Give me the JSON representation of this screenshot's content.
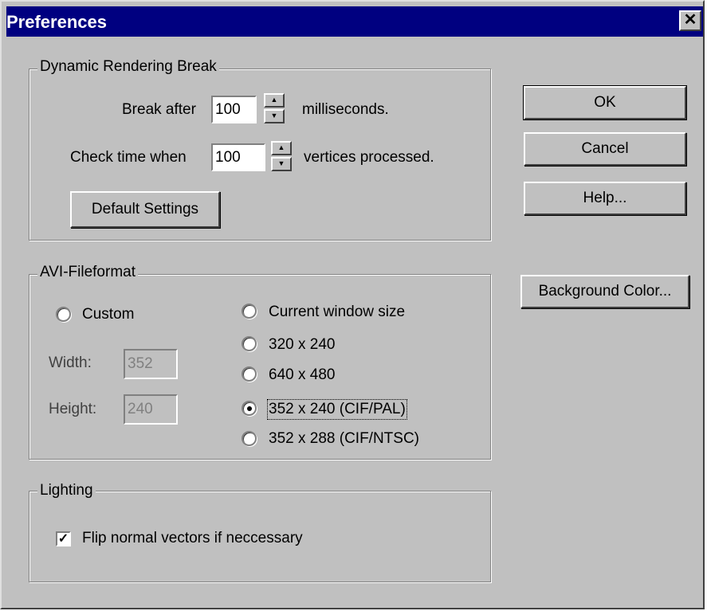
{
  "window": {
    "title": "Preferences",
    "close_glyph": "✕"
  },
  "rendering": {
    "group_label": "Dynamic Rendering Break",
    "break_after_label": "Break after",
    "break_after_value": "100",
    "break_after_unit": "milliseconds.",
    "check_time_label": "Check time when",
    "check_time_value": "100",
    "check_time_unit": "vertices processed.",
    "default_settings_label": "Default Settings"
  },
  "buttons": {
    "ok": "OK",
    "cancel": "Cancel",
    "help": "Help...",
    "background_color": "Background Color..."
  },
  "avi": {
    "group_label": "AVI-Fileformat",
    "custom_label": "Custom",
    "width_label": "Width:",
    "width_value": "352",
    "height_label": "Height:",
    "height_value": "240",
    "options": [
      {
        "label": "Current window size",
        "selected": false
      },
      {
        "label": "320 x 240",
        "selected": false
      },
      {
        "label": "640 x 480",
        "selected": false
      },
      {
        "label": "352 x 240 (CIF/PAL)",
        "selected": true
      },
      {
        "label": "352 x 288 (CIF/NTSC)",
        "selected": false
      }
    ]
  },
  "lighting": {
    "group_label": "Lighting",
    "flip_normals_label": "Flip normal vectors if neccessary",
    "flip_normals_checked": true
  }
}
